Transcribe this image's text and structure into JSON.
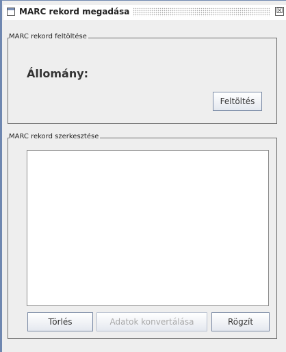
{
  "window": {
    "title": "MARC rekord megadása",
    "close_glyph": "☒",
    "icon": "window-icon"
  },
  "upload_section": {
    "legend": "MARC rekord feltöltése",
    "file_label": "Állomány:",
    "upload_button": "Feltöltés"
  },
  "edit_section": {
    "legend": "MARC rekord szerkesztése",
    "editor_value": "",
    "delete_button": "Törlés",
    "convert_button": "Adatok konvertálása",
    "save_button": "Rögzít"
  },
  "colors": {
    "frame_border": "#6f87b0",
    "panel_bg": "#eeeeee",
    "disabled_text": "#a8a8a8"
  }
}
